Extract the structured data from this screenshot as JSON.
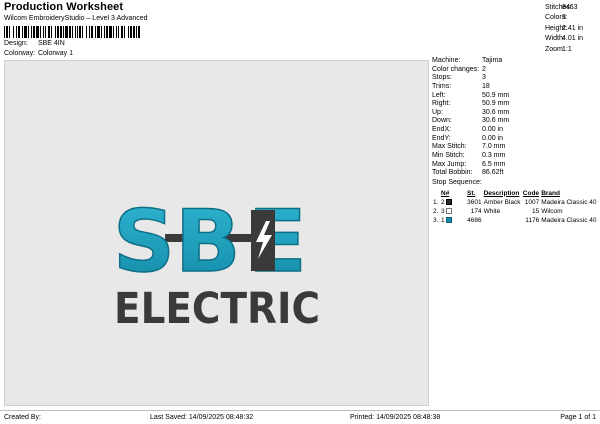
{
  "header": {
    "title": "Production Worksheet",
    "subtitle": "Wilcom EmbroideryStudio – Level 3 Advanced"
  },
  "meta": {
    "design_label": "Design:",
    "design_value": "SBE 4IN",
    "colorway_label": "Colorway:",
    "colorway_value": "Colorway 1"
  },
  "summary": [
    {
      "label": "Stitches:",
      "value": "8463"
    },
    {
      "label": "Colors:",
      "value": "3"
    },
    {
      "label": "Height:",
      "value": "2.41 in"
    },
    {
      "label": "Width:",
      "value": "4.01 in"
    },
    {
      "label": "Zoom:",
      "value": "1:1"
    }
  ],
  "logo": {
    "main": "SBE",
    "letters": [
      "S",
      "B",
      "E"
    ],
    "sub": "ELECTRIC",
    "colors": {
      "teal": "#1ea0bd",
      "teal_dark": "#117a92",
      "charcoal": "#3a3a3a",
      "white": "#ffffff"
    }
  },
  "details": [
    {
      "label": "Machine:",
      "value": "Tajima"
    },
    {
      "label": "Color changes:",
      "value": "2"
    },
    {
      "label": "Stops:",
      "value": "3"
    },
    {
      "label": "Trims:",
      "value": "18"
    },
    {
      "label": "Left:",
      "value": "50.9 mm"
    },
    {
      "label": "Right:",
      "value": "50.9 mm"
    },
    {
      "label": "Up:",
      "value": "30.6 mm"
    },
    {
      "label": "Down:",
      "value": "30.6 mm"
    },
    {
      "label": "EndX:",
      "value": "0.00 in"
    },
    {
      "label": "EndY:",
      "value": "0.00 in"
    },
    {
      "label": "Max Stitch:",
      "value": "7.0 mm"
    },
    {
      "label": "Min Stitch:",
      "value": "0.3 mm"
    },
    {
      "label": "Max Jump:",
      "value": "6.5 mm"
    },
    {
      "label": "Total Bobbin:",
      "value": "86.62ft"
    }
  ],
  "stop_sequence": {
    "label": "Stop Sequence:",
    "headers": {
      "n": "N#",
      "st": "St.",
      "description": "Description",
      "code": "Code",
      "brand": "Brand"
    },
    "rows": [
      {
        "idx": "1.",
        "n": "2",
        "color": "#2b2b2b",
        "st": "3601",
        "description": "Amber Black",
        "code": "1007",
        "brand": "Madeira Classic 40"
      },
      {
        "idx": "2.",
        "n": "3",
        "color": "#ffffff",
        "st": "174",
        "description": "White",
        "code": "15",
        "brand": "Wilcom"
      },
      {
        "idx": "3.",
        "n": "1",
        "color": "#1b88a8",
        "st": "4686",
        "description": "",
        "code": "1176",
        "brand": "Madeira Classic 40"
      }
    ]
  },
  "footer": {
    "created": "Created By:",
    "saved": "Last Saved: 14/09/2025 08:48:32",
    "printed": "Printed: 14/09/2025 08:48:38",
    "page": "Page 1 of 1"
  }
}
